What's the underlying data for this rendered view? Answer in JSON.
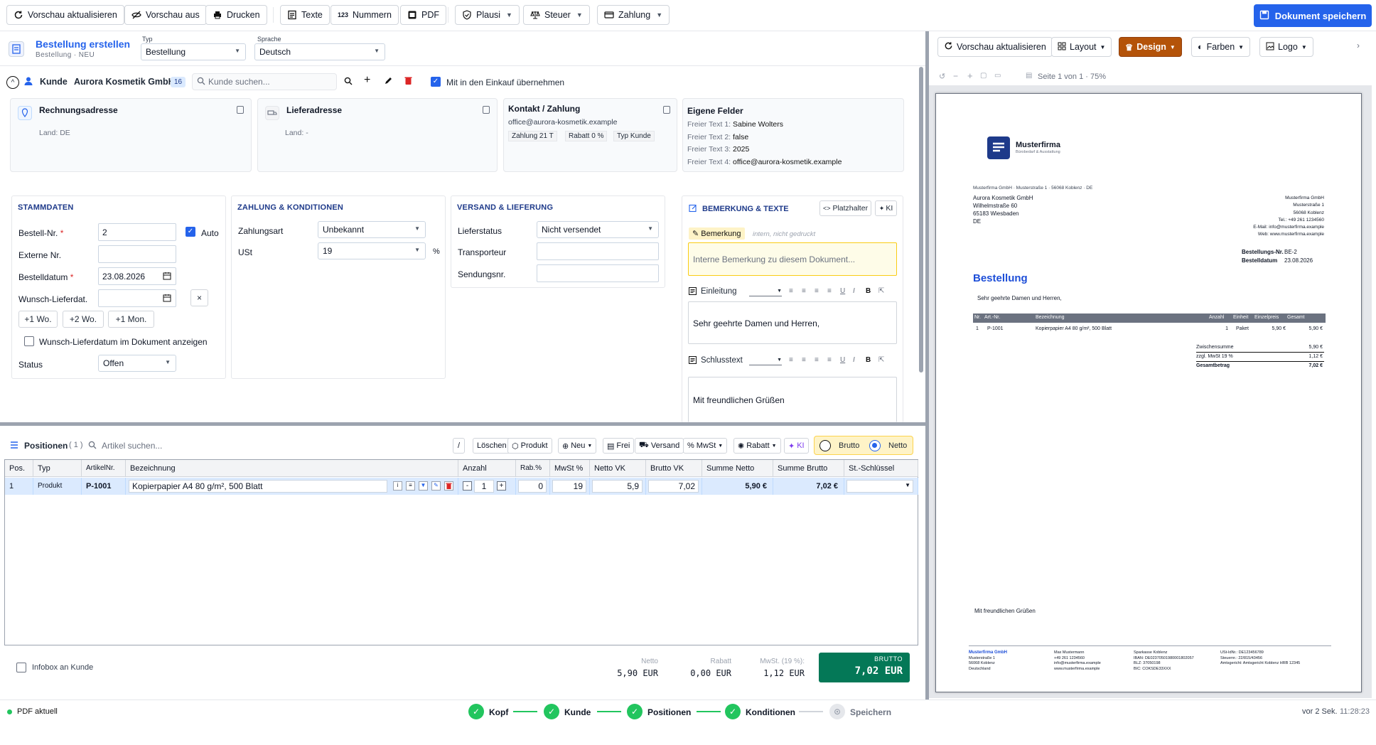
{
  "toolbar": {
    "refresh_preview": "Vorschau aktualisieren",
    "preview_off": "Vorschau aus",
    "print": "Drucken",
    "texts": "Texte",
    "numbers": "Nummern",
    "numbers_icon": "123",
    "pdf": "PDF",
    "plausi": "Plausi",
    "tax": "Steuer",
    "payment": "Zahlung",
    "save": "Dokument speichern"
  },
  "header": {
    "title": "Bestellung erstellen",
    "subtitle": "Bestellung · NEU",
    "type_label": "Typ",
    "type_value": "Bestellung",
    "lang_label": "Sprache",
    "lang_value": "Deutsch"
  },
  "customer": {
    "label": "Kunde",
    "name": "Aurora Kosmetik GmbH",
    "badge": "16",
    "search_placeholder": "Kunde suchen...",
    "purchase_label": "Mit in den Einkauf übernehmen"
  },
  "cards": {
    "billing_title": "Rechnungsadresse",
    "billing_country": "Land:  DE",
    "shipping_title": "Lieferadresse",
    "shipping_country": "Land:  -",
    "contact_title": "Kontakt / Zahlung",
    "contact_email": "office@aurora-kosmetik.example",
    "contact_payment": "Zahlung  21 T",
    "contact_discount": "Rabatt  0 %",
    "contact_type": "Typ  Kunde",
    "custom_title": "Eigene Felder",
    "custom_fields": [
      {
        "label": "Freier Text 1:",
        "value": "Sabine Wolters"
      },
      {
        "label": "Freier Text 2:",
        "value": "false"
      },
      {
        "label": "Freier Text 3:",
        "value": "2025"
      },
      {
        "label": "Freier Text 4:",
        "value": "office@aurora-kosmetik.example"
      }
    ]
  },
  "master": {
    "title": "STAMMDATEN",
    "order_no_label": "Bestell-Nr.",
    "order_no_value": "2",
    "auto_label": "Auto",
    "ext_no_label": "Externe Nr.",
    "date_label": "Bestelldatum",
    "date_value": "23.08.2026",
    "wish_label": "Wunsch-Lieferdat.",
    "clear": "×",
    "plus1w": "+1 Wo.",
    "plus2w": "+2 Wo.",
    "plus1m": "+1 Mon.",
    "show_wish_label": "Wunsch-Lieferdatum im Dokument anzeigen",
    "status_label": "Status",
    "status_value": "Offen"
  },
  "payment": {
    "title": "ZAHLUNG & KONDITIONEN",
    "type_label": "Zahlungsart",
    "type_value": "Unbekannt",
    "vat_label": "USt",
    "vat_value": "19",
    "vat_unit": "%"
  },
  "shipping": {
    "title": "VERSAND & LIEFERUNG",
    "status_label": "Lieferstatus",
    "status_value": "Nicht versendet",
    "carrier_label": "Transporteur",
    "tracking_label": "Sendungsnr."
  },
  "remarks": {
    "title": "BEMERKUNG & TEXTE",
    "placeholder_btn": "Platzhalter",
    "ai_btn": "KI",
    "remark_tag": "Bemerkung",
    "remark_hint": "intern, nicht gedruckt",
    "remark_placeholder": "Interne Bemerkung zu diesem Dokument...",
    "intro_label": "Einleitung",
    "intro_text": "Sehr geehrte Damen und Herren,",
    "closing_label": "Schlusstext",
    "closing_text": "Mit freundlichen Grüßen"
  },
  "positions": {
    "title": "Positionen",
    "count": "( 1 )",
    "search_placeholder": "Artikel suchen...",
    "slash": "/",
    "delete": "Löschen",
    "product": "Produkt",
    "new": "Neu",
    "free": "Frei",
    "shipping": "Versand",
    "vat": "MwSt",
    "discount": "Rabatt",
    "ai": "KI",
    "gross": "Brutto",
    "net": "Netto",
    "columns": [
      "Pos.",
      "Typ",
      "ArtikelNr.",
      "Bezeichnung",
      "Anzahl",
      "Rab.%",
      "MwSt %",
      "Netto VK",
      "Brutto VK",
      "Summe Netto",
      "Summe Brutto",
      "St.-Schlüssel"
    ],
    "rows": [
      {
        "pos": "1",
        "type": "Produkt",
        "artno": "P-1001",
        "desc": "Kopierpapier A4 80 g/m², 500 Blatt",
        "qty": "1",
        "disc": "0",
        "vat": "19",
        "net": "5,9",
        "gross": "7,02",
        "sum_net": "5,90 €",
        "sum_gross": "7,02 €"
      }
    ]
  },
  "totals": {
    "infobox": "Infobox an Kunde",
    "net_label": "Netto",
    "net_value": "5,90 EUR",
    "disc_label": "Rabatt",
    "disc_value": "0,00 EUR",
    "vat_label": "MwSt. (19 %):",
    "vat_value": "1,12 EUR",
    "gross_label": "BRUTTO",
    "gross_value": "7,02 EUR"
  },
  "status": {
    "pdf": "PDF aktuell",
    "steps": [
      "Kopf",
      "Kunde",
      "Positionen",
      "Konditionen",
      "Speichern"
    ],
    "time_ago": "vor 2 Sek.",
    "time": "11:28:23"
  },
  "preview": {
    "refresh": "Vorschau aktualisieren",
    "layout": "Layout",
    "design": "Design",
    "colors": "Farben",
    "logo": "Logo",
    "page_info": "Seite 1 von 1 · 75%"
  },
  "paper": {
    "company": "Musterfirma",
    "company_tagline": "Bürobedarf & Ausstattung",
    "sender_line": "Musterfirma GmbH · Musterstraße 1 · 56068 Koblenz · DE",
    "recipient": [
      "Aurora Kosmetik GmbH",
      "Wilhelmstraße 60",
      "65183 Wiesbaden",
      "DE"
    ],
    "sender_block": [
      "Musterfirma GmbH",
      "Musterstraße 1",
      "56068 Koblenz",
      "Tel.: +49 261 1234560",
      "E-Mail: info@musterfirma.example",
      "Web: www.musterfirma.example"
    ],
    "order_no_label": "Bestellungs-Nr.",
    "order_no": "BE-2",
    "date_label": "Bestelldatum",
    "date": "23.08.2026",
    "heading": "Bestellung",
    "salutation": "Sehr geehrte Damen und Herren,",
    "table_head": [
      "Nr.",
      "Art.-Nr.",
      "Bezeichnung",
      "Anzahl",
      "Einheit",
      "Einzelpreis",
      "Gesamt"
    ],
    "table_row": [
      "1",
      "P-1001",
      "Kopierpapier A4 80 g/m², 500 Blatt",
      "1",
      "Paket",
      "5,90 €",
      "5,90 €"
    ],
    "subtotal_label": "Zwischensumme",
    "subtotal": "5,90 €",
    "vat_label": "zzgl. MwSt 19 %",
    "vat": "1,12 €",
    "total_label": "Gesamtbetrag",
    "total": "7,02 €",
    "closing": "Mit freundlichen Grüßen",
    "footer_col1": [
      "Musterfirma GmbH",
      "Musterstraße 1",
      "56068 Koblenz",
      "Deutschland"
    ],
    "footer_col2": [
      "Max Mustermann",
      "+49 261 1234560",
      "info@musterfirma.example",
      "www.musterfirma.example"
    ],
    "footer_col3": [
      "Sparkasse Koblenz",
      "IBAN: DE02370501980001802057",
      "BLZ: 37050198",
      "BIC: COKSDE33XXX"
    ],
    "footer_col4": [
      "USt-IdNr.: DE123456789",
      "Steuernr.: 22/815/43456",
      "Amtsgericht: Amtsgericht Koblenz HRB 12345"
    ]
  },
  "colors": {
    "accent": "#2563eb",
    "design_btn": "#b45309",
    "brutto_bg": "#047857",
    "step_done": "#22c55e"
  }
}
